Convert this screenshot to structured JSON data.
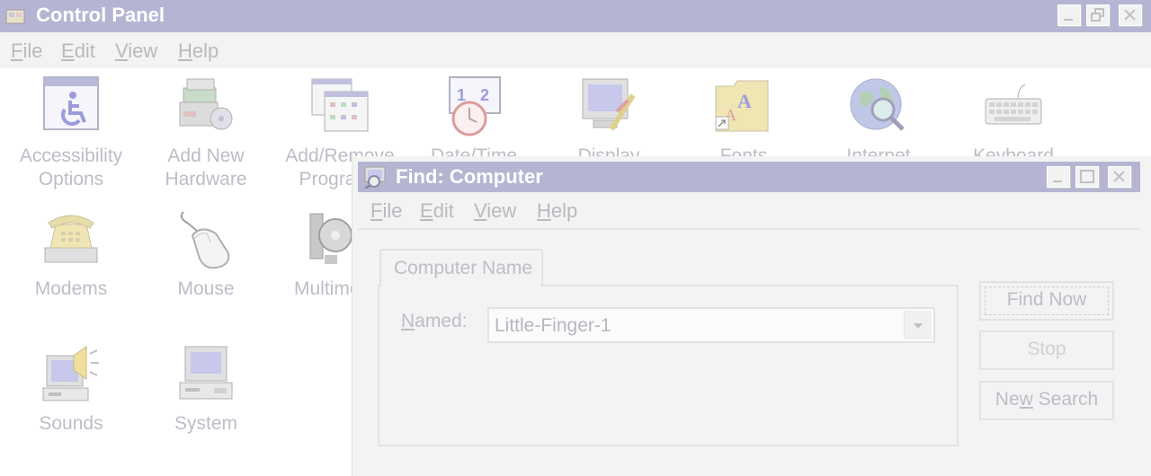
{
  "window": {
    "title": "Control Panel",
    "menu": [
      {
        "label": "File",
        "hotkey": "F",
        "rest": "ile"
      },
      {
        "label": "Edit",
        "hotkey": "E",
        "rest": "dit"
      },
      {
        "label": "View",
        "hotkey": "V",
        "rest": "iew"
      },
      {
        "label": "Help",
        "hotkey": "H",
        "rest": "elp"
      }
    ]
  },
  "control_panel": {
    "items": [
      {
        "label1": "Accessibility",
        "label2": "Options",
        "icon": "accessibility-icon"
      },
      {
        "label1": "Add New",
        "label2": "Hardware",
        "icon": "add-hardware-icon"
      },
      {
        "label1": "Add/Remove",
        "label2": "Programs",
        "icon": "add-remove-programs-icon"
      },
      {
        "label1": "Date/Time",
        "label2": "",
        "icon": "date-time-icon"
      },
      {
        "label1": "Display",
        "label2": "",
        "icon": "display-icon"
      },
      {
        "label1": "Fonts",
        "label2": "",
        "icon": "fonts-icon"
      },
      {
        "label1": "Internet",
        "label2": "",
        "icon": "internet-icon"
      },
      {
        "label1": "Keyboard",
        "label2": "",
        "icon": "keyboard-icon"
      },
      {
        "label1": "Modems",
        "label2": "",
        "icon": "modems-icon"
      },
      {
        "label1": "Mouse",
        "label2": "",
        "icon": "mouse-icon"
      },
      {
        "label1": "Multimedia",
        "label2": "",
        "icon": "multimedia-icon"
      },
      {
        "label1": "Sounds",
        "label2": "",
        "icon": "sounds-icon"
      },
      {
        "label1": "System",
        "label2": "",
        "icon": "system-icon"
      }
    ]
  },
  "find_dialog": {
    "title": "Find: Computer",
    "menu": [
      {
        "label": "File",
        "hotkey": "F",
        "rest": "ile"
      },
      {
        "label": "Edit",
        "hotkey": "E",
        "rest": "dit"
      },
      {
        "label": "View",
        "hotkey": "V",
        "rest": "iew"
      },
      {
        "label": "Help",
        "hotkey": "H",
        "rest": "elp"
      }
    ],
    "tab": "Computer Name",
    "named_label": {
      "hotkey": "N",
      "rest": "amed:"
    },
    "named_value": "Little-Finger-1",
    "buttons": {
      "find_now": "Find Now",
      "stop": "Stop",
      "new_search": {
        "pre": "Ne",
        "hotkey": "w",
        "post": " Search"
      }
    }
  },
  "colors": {
    "titlebar": "#b5b5d3",
    "menubar": "#f3f3f3",
    "text": "#bdbdc8"
  }
}
